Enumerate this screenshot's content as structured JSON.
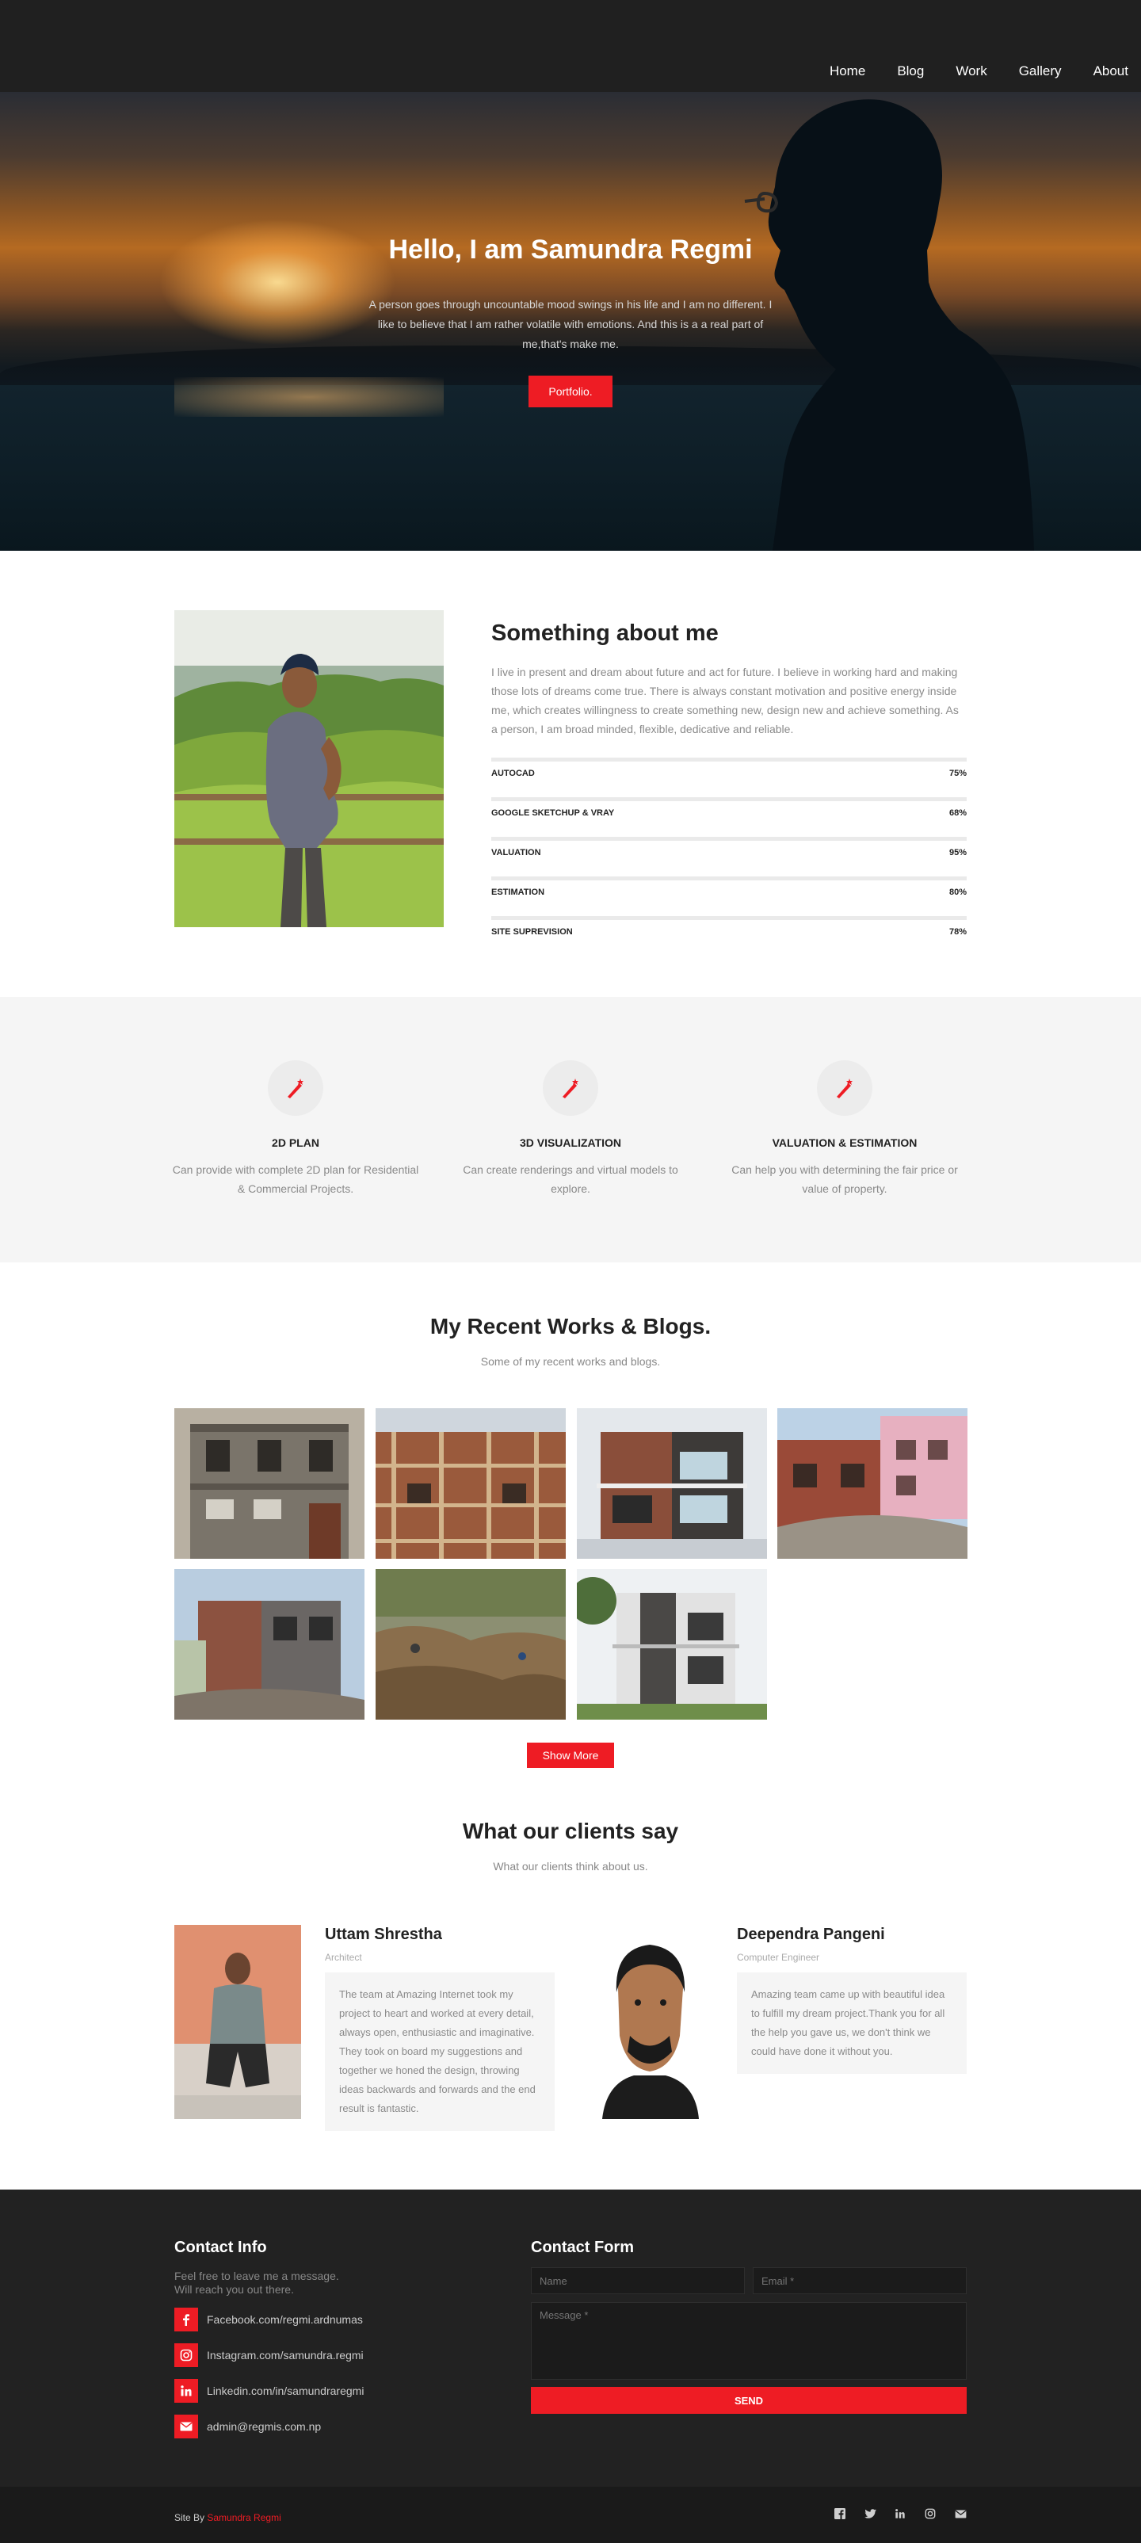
{
  "nav": {
    "items": [
      "Home",
      "Blog",
      "Work",
      "Gallery",
      "About"
    ]
  },
  "hero": {
    "title": "Hello, I am Samundra Regmi",
    "text": "A person goes through uncountable mood swings in his life and I am no different. I like to believe that I am rather volatile with emotions. And this is a a real part of me,that's make me.",
    "button": "Portfolio."
  },
  "about": {
    "title": "Something about me",
    "text": "I live in present and dream about future and act for future. I believe in working hard and making those lots of dreams come true. There is always constant motivation and positive energy inside me, which creates willingness to create something new, design new and achieve something. As a person, I am broad minded, flexible, dedicative and reliable.",
    "skills": [
      {
        "label": "AUTOCAD",
        "pct": "75%"
      },
      {
        "label": "GOOGLE SKETCHUP & VRAY",
        "pct": "68%"
      },
      {
        "label": "VALUATION",
        "pct": "95%"
      },
      {
        "label": "ESTIMATION",
        "pct": "80%"
      },
      {
        "label": "SITE SUPREVISION",
        "pct": "78%"
      }
    ]
  },
  "services": [
    {
      "title": "2D PLAN",
      "text": "Can provide with complete 2D plan for Residential & Commercial Projects.",
      "icon": "magic-wand-icon"
    },
    {
      "title": "3D VISUALIZATION",
      "text": "Can create renderings and virtual models to explore.",
      "icon": "magic-wand-icon"
    },
    {
      "title": "VALUATION & ESTIMATION",
      "text": "Can help you with determining the fair price or value of property.",
      "icon": "magic-wand-icon"
    }
  ],
  "works": {
    "title": "My Recent Works & Blogs.",
    "subtitle": "Some of my recent works and blogs.",
    "button": "Show More"
  },
  "clients": {
    "title": "What our clients say",
    "subtitle": "What our clients think about us.",
    "items": [
      {
        "name": "Uttam Shrestha",
        "role": "Architect",
        "quote": "The team at Amazing Internet took my project to heart and worked at every detail, always open, enthusiastic and imaginative. They took on board my suggestions and together we honed the design, throwing ideas backwards and forwards and the end result is fantastic."
      },
      {
        "name": "Deependra Pangeni",
        "role": "Computer Engineer",
        "quote": "Amazing team came up with beautiful idea to fulfill my dream project.Thank you for all the help you gave us, we don't think we could have done it without you."
      }
    ]
  },
  "footer": {
    "contact_info_title": "Contact Info",
    "contact_info_sub1": "Feel free to leave me a message.",
    "contact_info_sub2": "Will reach you out there.",
    "contacts": [
      {
        "icon": "facebook-icon",
        "text": "Facebook.com/regmi.ardnumas"
      },
      {
        "icon": "instagram-icon",
        "text": "Instagram.com/samundra.regmi"
      },
      {
        "icon": "linkedin-icon",
        "text": "Linkedin.com/in/samundraregmi"
      },
      {
        "icon": "mail-icon",
        "text": "admin@regmis.com.np"
      }
    ],
    "form_title": "Contact Form",
    "name_placeholder": "Name",
    "email_placeholder": "Email *",
    "message_placeholder": "Message *",
    "send": "SEND",
    "credit_prefix": "Site By",
    "credit_name": "Samundra Regmi"
  },
  "colors": {
    "accent": "#ee1c24",
    "dark": "#222222"
  }
}
